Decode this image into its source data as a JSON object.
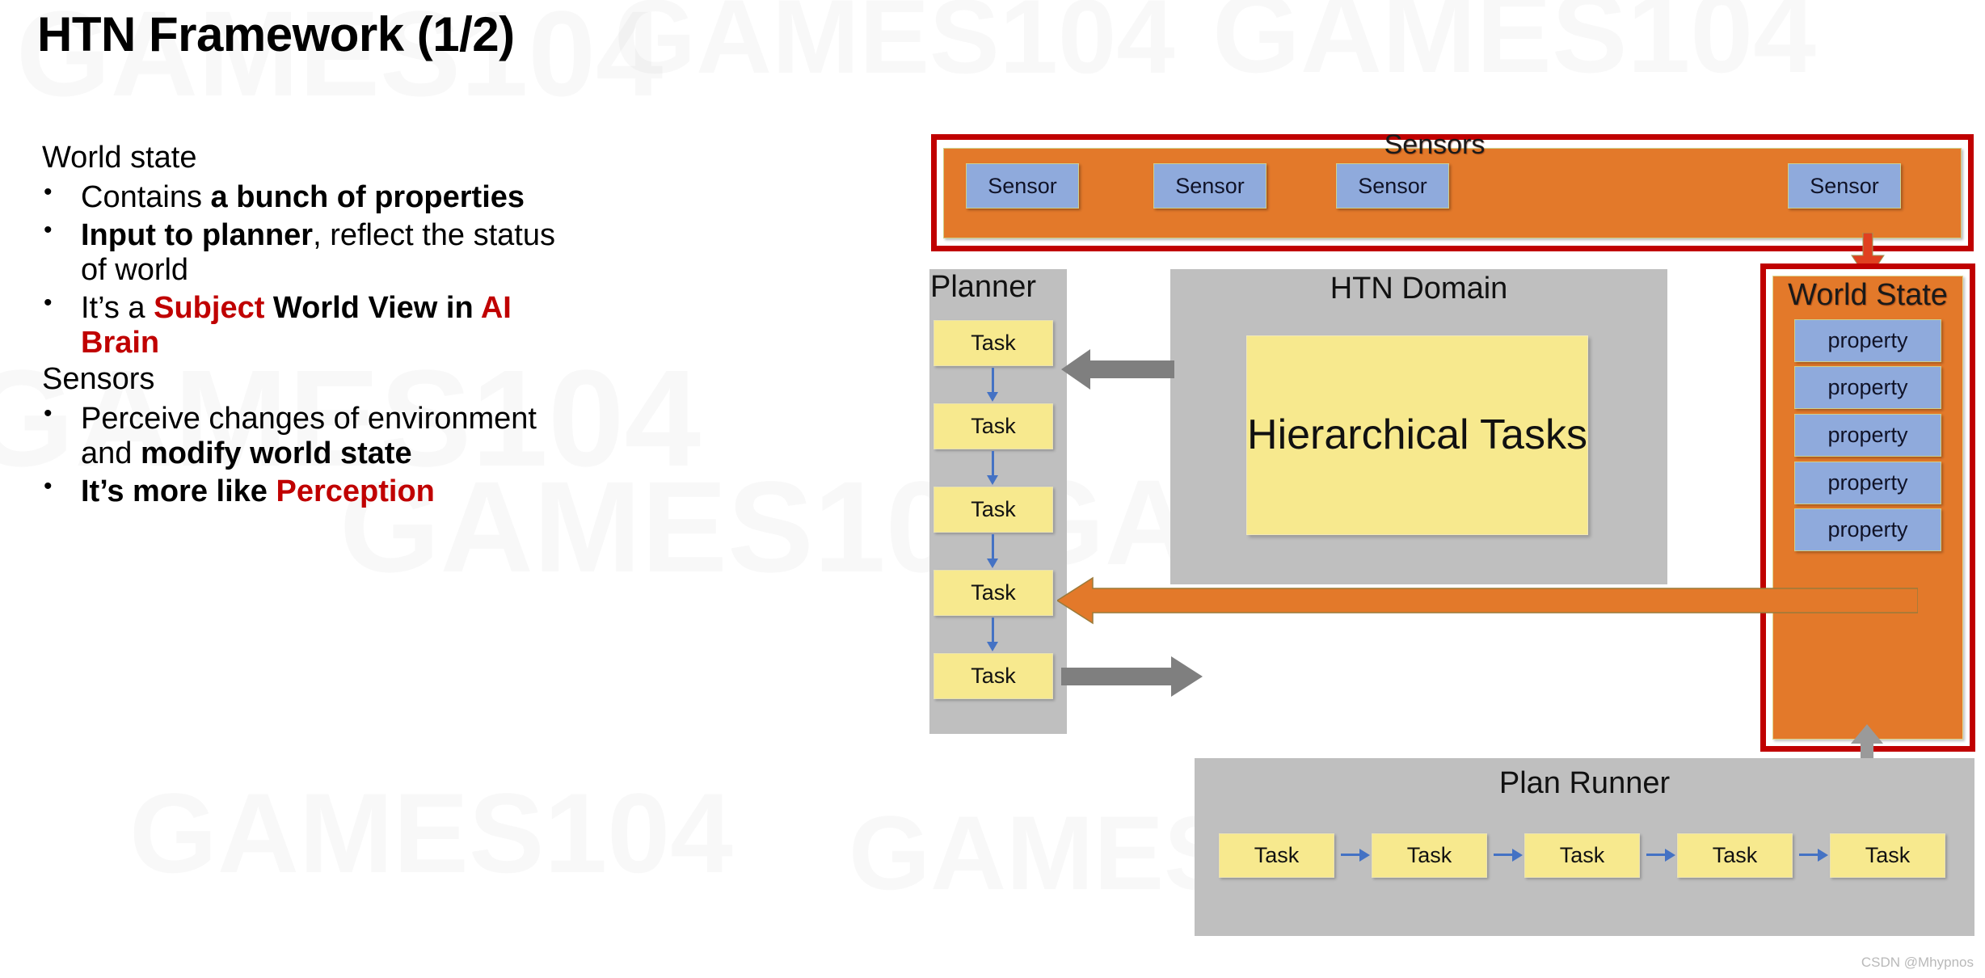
{
  "slide": {
    "title": "HTN Framework (1/2)",
    "credit": "CSDN @Mhypnos",
    "watermark_text": "GAMES104"
  },
  "content": {
    "sections": [
      {
        "heading": "World state",
        "bullets": [
          {
            "parts": [
              {
                "text": "Contains ",
                "style": "normal"
              },
              {
                "text": "a bunch of properties",
                "style": "bold"
              }
            ]
          },
          {
            "parts": [
              {
                "text": "Input to planner",
                "style": "bold"
              },
              {
                "text": ", reflect the status of world",
                "style": "normal"
              }
            ]
          },
          {
            "parts": [
              {
                "text": "It’s a ",
                "style": "normal"
              },
              {
                "text": "Subject",
                "style": "red"
              },
              {
                "text": " World View in ",
                "style": "bold"
              },
              {
                "text": "AI Brain",
                "style": "red"
              }
            ]
          }
        ]
      },
      {
        "heading": "Sensors",
        "bullets": [
          {
            "parts": [
              {
                "text": "Perceive changes of environment and ",
                "style": "normal"
              },
              {
                "text": "modify world state",
                "style": "bold"
              }
            ]
          },
          {
            "parts": [
              {
                "text": "It’s more like ",
                "style": "bold"
              },
              {
                "text": "Perception",
                "style": "red"
              }
            ]
          }
        ]
      }
    ]
  },
  "diagram": {
    "sensors": {
      "title": "Sensors",
      "items": [
        "Sensor",
        "Sensor",
        "Sensor",
        "Sensor"
      ]
    },
    "planner": {
      "title": "Planner",
      "tasks": [
        "Task",
        "Task",
        "Task",
        "Task",
        "Task"
      ]
    },
    "htn_domain": {
      "title": "HTN Domain",
      "box_label": "Hierarchical Tasks"
    },
    "world_state": {
      "title": "World State",
      "properties": [
        "property",
        "property",
        "property",
        "property",
        "property"
      ]
    },
    "plan_runner": {
      "title": "Plan Runner",
      "tasks": [
        "Task",
        "Task",
        "Task",
        "Task",
        "Task"
      ]
    },
    "connections": [
      {
        "name": "sensors-to-world-state",
        "direction": "down",
        "color": "#E04020"
      },
      {
        "name": "htn-domain-to-planner",
        "direction": "left",
        "color": "#7F7F7F"
      },
      {
        "name": "world-state-to-planner",
        "direction": "left",
        "color": "#E3792A"
      },
      {
        "name": "planner-to-plan-runner",
        "direction": "right",
        "color": "#7F7F7F"
      },
      {
        "name": "plan-runner-to-world-state",
        "direction": "up",
        "color": "#9A9A9A"
      }
    ]
  },
  "colors": {
    "orange": "#E3792A",
    "red_border": "#C00000",
    "blue_box": "#8FAADC",
    "yellow_box": "#F7E98E",
    "gray_panel": "#BFBFBF",
    "arrow_blue": "#4472C4",
    "arrow_gray": "#7F7F7F",
    "accent_red_text": "#C00000"
  }
}
